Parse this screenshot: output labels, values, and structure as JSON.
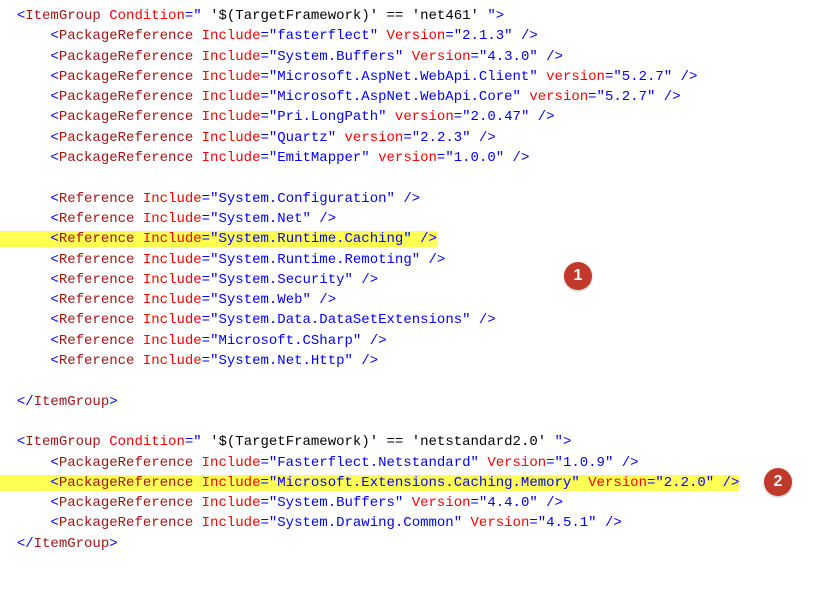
{
  "group1": {
    "condition": " '$(TargetFramework)' == 'net461' ",
    "pkg": [
      {
        "include": "fasterflect",
        "vattr": "Version",
        "version": "2.1.3"
      },
      {
        "include": "System.Buffers",
        "vattr": "Version",
        "version": "4.3.0"
      },
      {
        "include": "Microsoft.AspNet.WebApi.Client",
        "vattr": "version",
        "version": "5.2.7"
      },
      {
        "include": "Microsoft.AspNet.WebApi.Core",
        "vattr": "version",
        "version": "5.2.7"
      },
      {
        "include": "Pri.LongPath",
        "vattr": "version",
        "version": "2.0.47"
      },
      {
        "include": "Quartz",
        "vattr": "version",
        "version": "2.2.3"
      },
      {
        "include": "EmitMapper",
        "vattr": "version",
        "version": "1.0.0"
      }
    ],
    "ref": [
      {
        "include": "System.Configuration"
      },
      {
        "include": "System.Net"
      },
      {
        "include": "System.Runtime.Caching",
        "hl": true
      },
      {
        "include": "System.Runtime.Remoting"
      },
      {
        "include": "System.Security"
      },
      {
        "include": "System.Web"
      },
      {
        "include": "System.Data.DataSetExtensions"
      },
      {
        "include": "Microsoft.CSharp"
      },
      {
        "include": "System.Net.Http"
      }
    ]
  },
  "group2": {
    "condition": " '$(TargetFramework)' == 'netstandard2.0' ",
    "pkg": [
      {
        "include": "Fasterflect.Netstandard",
        "vattr": "Version",
        "version": "1.0.9"
      },
      {
        "include": "Microsoft.Extensions.Caching.Memory",
        "vattr": "Version",
        "version": "2.2.0",
        "hl": true
      },
      {
        "include": "System.Buffers",
        "vattr": "Version",
        "version": "4.4.0"
      },
      {
        "include": "System.Drawing.Common",
        "vattr": "Version",
        "version": "4.5.1"
      }
    ]
  },
  "badges": {
    "b1": "1",
    "b2": "2"
  }
}
